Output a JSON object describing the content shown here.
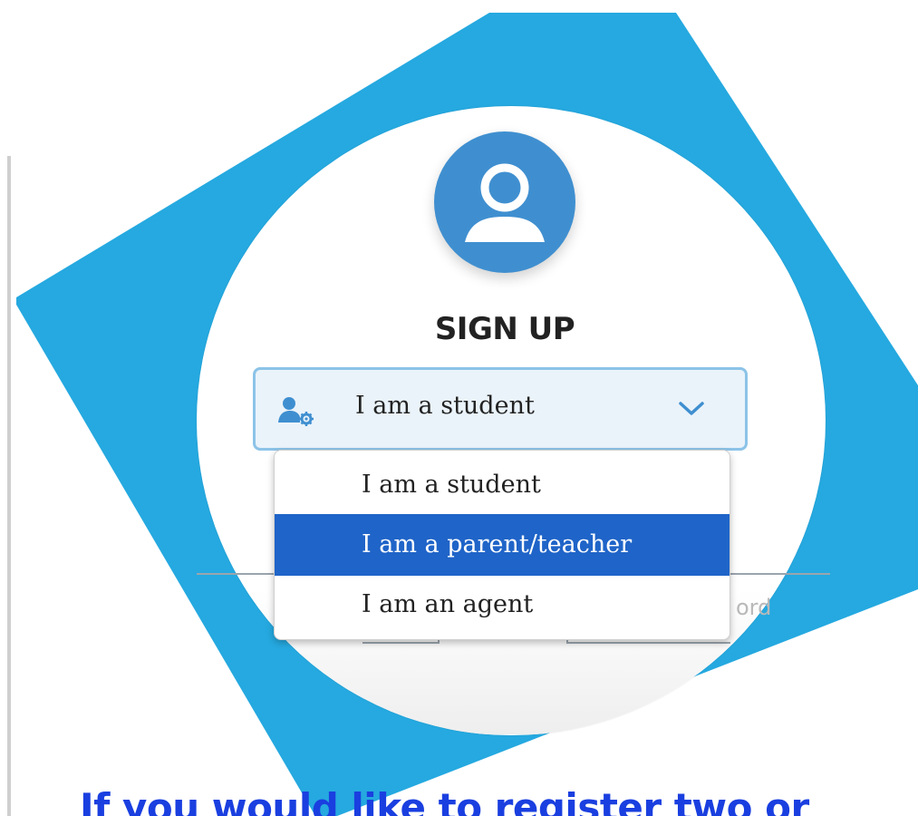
{
  "colors": {
    "accent_blue": "#25a9e0",
    "avatar_blue": "#3f8fd0",
    "selected_option_bg": "#1f64c8",
    "caption_blue": "#1a3fe0"
  },
  "form": {
    "title": "SIGN UP",
    "avatar_icon": "user-profile-icon",
    "role_select": {
      "icon": "user-gear-icon",
      "value": "I am a student",
      "options": [
        "I am a student",
        "I am a parent/teacher",
        "I am an agent"
      ],
      "highlighted_option": "I am a parent/teacher"
    },
    "partial_placeholder": "ord"
  },
  "caption": "If you would like to register two or"
}
